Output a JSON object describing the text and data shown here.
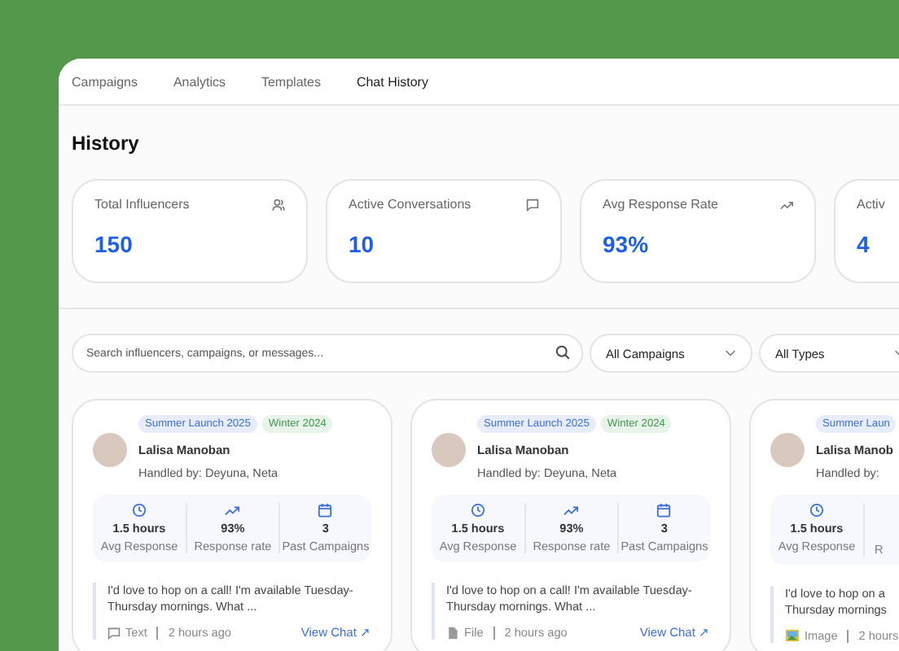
{
  "tabs": [
    {
      "label": "Campaigns",
      "selected": false
    },
    {
      "label": "Analytics",
      "selected": false
    },
    {
      "label": "Templates",
      "selected": false
    },
    {
      "label": "Chat History",
      "selected": true
    }
  ],
  "heading": "History",
  "stats": [
    {
      "label": "Total Influencers",
      "value": "150"
    },
    {
      "label": "Active Conversations",
      "value": "10"
    },
    {
      "label": "Avg Response Rate",
      "value": "93%"
    },
    {
      "label": "Activ",
      "value": "4"
    }
  ],
  "search": {
    "placeholder": "Search influencers, campaigns, or messages..."
  },
  "filters": [
    "All Campaigns",
    "All Types"
  ],
  "chats": [
    {
      "tags": [
        {
          "label": "Summer Launch 2025",
          "color": "#3b6fe0"
        },
        {
          "label": "Winter 2024",
          "color": "#3f9a4a"
        }
      ],
      "name": "Lalisa Manoban",
      "handled": "Handled by: Deyuna, Neta",
      "metrics": [
        {
          "value": "1.5 hours",
          "label": "Avg Response"
        },
        {
          "value": "93%",
          "label": "Response rate"
        },
        {
          "value": "3",
          "label": "Past Campaigns"
        }
      ],
      "message": [
        "I'd love to hop on a call! I'm available Tuesday-",
        "Thursday mornings. What ..."
      ],
      "type": {
        "kind": "text",
        "label": "Text"
      },
      "time": "2 hours ago",
      "link": "View Chat ↗"
    },
    {
      "tags": [
        {
          "label": "Summer Launch 2025",
          "color": "#3b6fe0"
        },
        {
          "label": "Winter 2024",
          "color": "#3f9a4a"
        }
      ],
      "name": "Lalisa Manoban",
      "handled": "Handled by: Deyuna, Neta",
      "metrics": [
        {
          "value": "1.5 hours",
          "label": "Avg Response"
        },
        {
          "value": "93%",
          "label": "Response rate"
        },
        {
          "value": "3",
          "label": "Past Campaigns"
        }
      ],
      "message": [
        "I'd love to hop on a call! I'm available Tuesday-",
        "Thursday mornings. What ..."
      ],
      "type": {
        "kind": "file",
        "label": "File"
      },
      "time": "2 hours ago",
      "link": "View Chat ↗"
    },
    {
      "tags": [
        {
          "label": "Summer Laun",
          "color": "#3b6fe0"
        }
      ],
      "name": "Lalisa Manob",
      "handled": "Handled by:",
      "metrics": [
        {
          "value": "1.5 hours",
          "label": "Avg Response"
        },
        {
          "label": "R"
        }
      ],
      "message": [
        "I'd love to hop on a",
        "Thursday mornings"
      ],
      "type": {
        "kind": "image",
        "label": "Image"
      },
      "time": "2 hours"
    }
  ]
}
